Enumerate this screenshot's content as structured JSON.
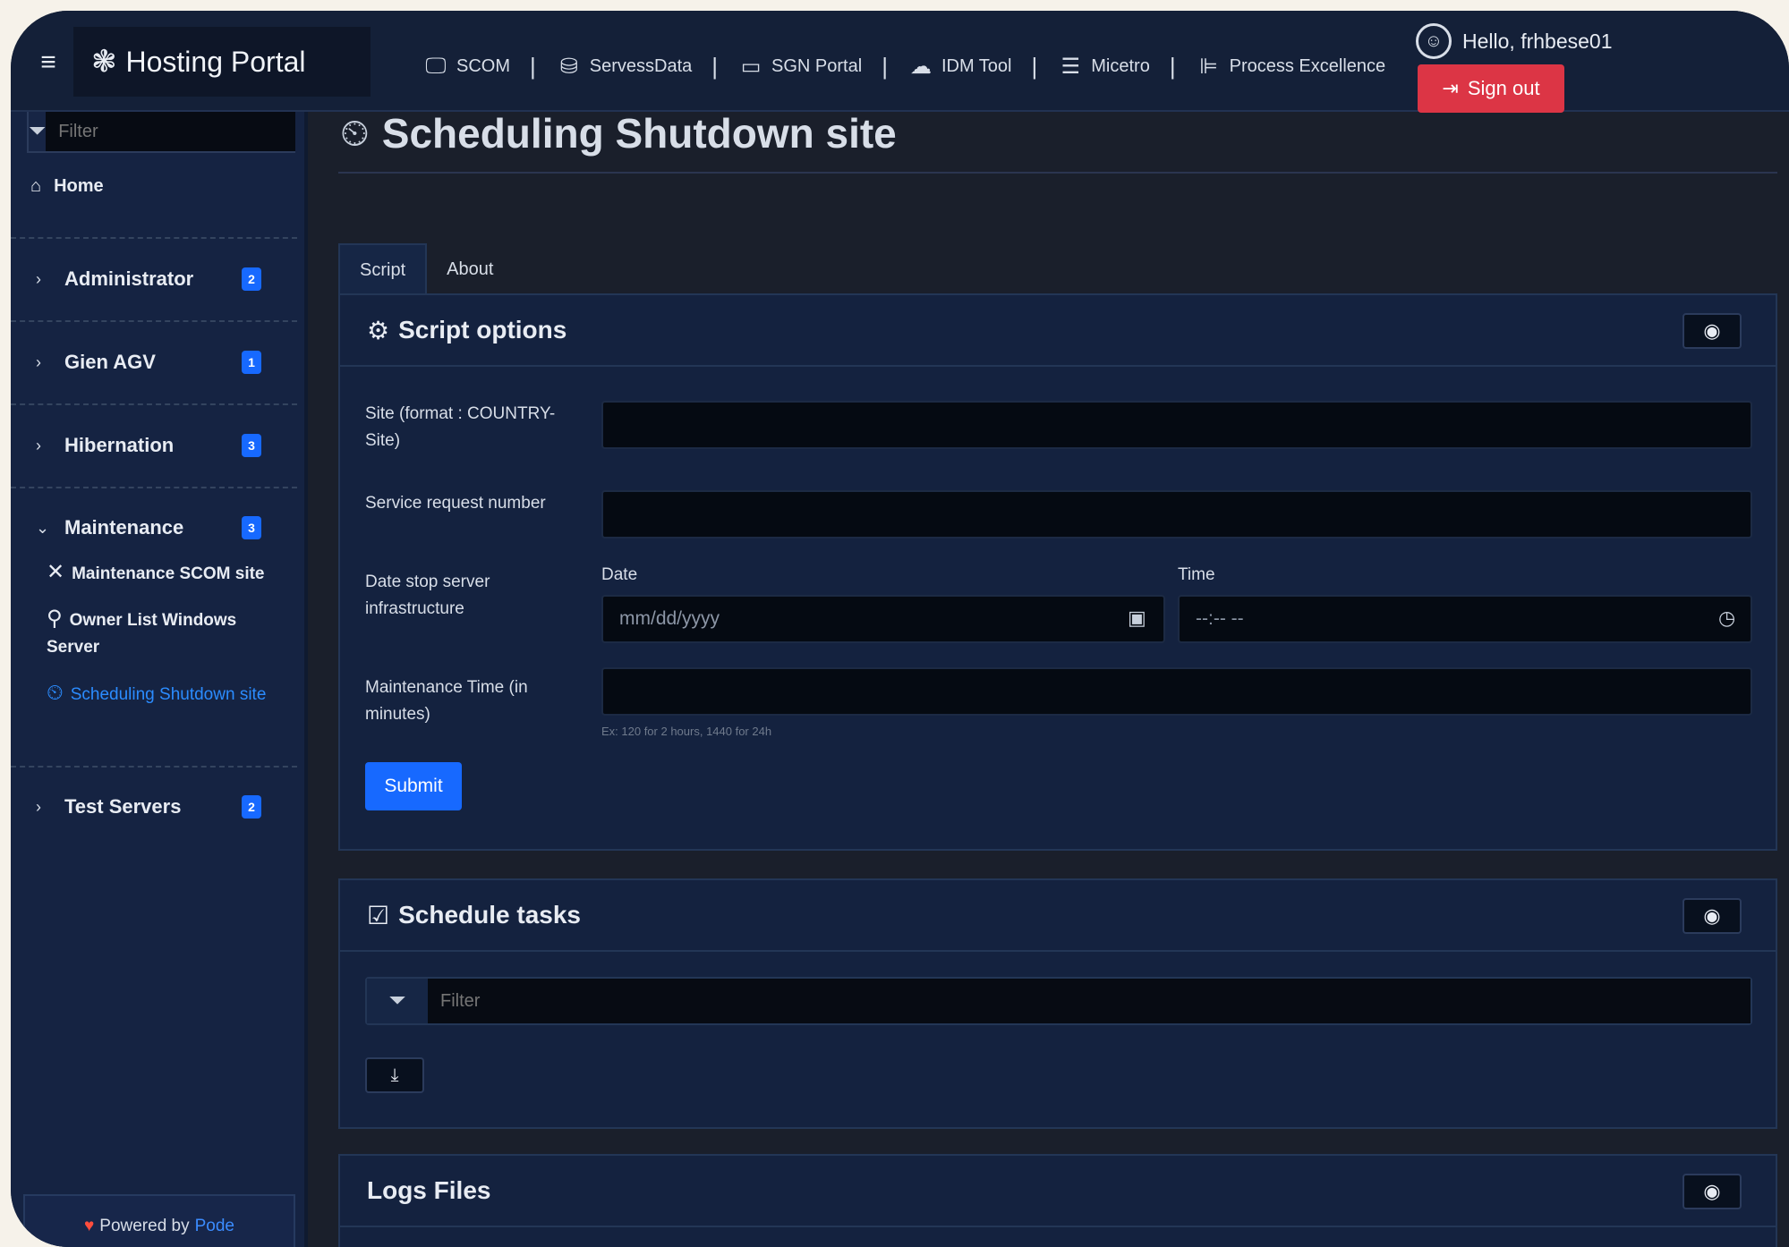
{
  "header": {
    "brand_title": "Hosting Portal",
    "nav": [
      {
        "icon": "monitor-icon",
        "label": "SCOM"
      },
      {
        "icon": "database-icon",
        "label": "ServessData"
      },
      {
        "icon": "window-icon",
        "label": "SGN Portal"
      },
      {
        "icon": "cloud-lock-icon",
        "label": "IDM Tool"
      },
      {
        "icon": "server-icon",
        "label": "Micetro"
      },
      {
        "icon": "gantt-icon",
        "label": "Process Excellence"
      }
    ],
    "separator": "|",
    "user_greeting": "Hello, frhbese01",
    "signout_label": "Sign out",
    "signout_color": "#dc3545"
  },
  "sidebar": {
    "filter_placeholder": "Filter",
    "home_label": "Home",
    "groups": [
      {
        "label": "Administrator",
        "badge": "2",
        "expanded": false
      },
      {
        "label": "Gien AGV",
        "badge": "1",
        "expanded": false
      },
      {
        "label": "Hibernation",
        "badge": "3",
        "expanded": false
      },
      {
        "label": "Maintenance",
        "badge": "3",
        "expanded": true
      },
      {
        "label": "Test Servers",
        "badge": "2",
        "expanded": false
      }
    ],
    "maintenance_items": [
      {
        "label": "Maintenance SCOM site",
        "active": false
      },
      {
        "label": "Owner List Windows Server",
        "active": false
      },
      {
        "label": "Scheduling Shutdown site",
        "active": true
      }
    ],
    "powered_prefix": "Powered by",
    "powered_name": "Pode",
    "accent_color": "#1769ff"
  },
  "main": {
    "page_title": "Scheduling Shutdown site",
    "tabs": [
      {
        "label": "Script",
        "active": true
      },
      {
        "label": "About",
        "active": false
      }
    ],
    "script_options": {
      "title": "Script options",
      "site_label": "Site (format : COUNTRY-Site)",
      "site_value": "",
      "service_request_label": "Service request number",
      "service_request_value": "",
      "date_stop_label": "Date stop server infrastructure",
      "date_label": "Date",
      "date_placeholder": "mm/dd/yyyy",
      "time_label": "Time",
      "time_placeholder": "--:-- --",
      "maintenance_time_label": "Maintenance Time (in minutes)",
      "maintenance_time_value": "",
      "maintenance_time_hint": "Ex: 120 for 2 hours, 1440 for 24h",
      "submit_label": "Submit"
    },
    "schedule_tasks": {
      "title": "Schedule tasks",
      "filter_placeholder": "Filter"
    },
    "logs_files": {
      "title": "Logs Files"
    }
  }
}
